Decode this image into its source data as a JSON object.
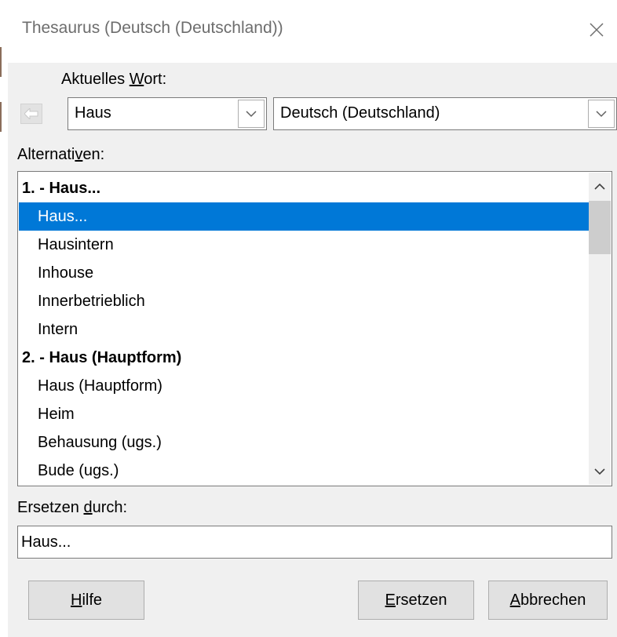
{
  "window": {
    "title": "Thesaurus (Deutsch (Deutschland))",
    "close_icon": "close-icon"
  },
  "current_word": {
    "label_pre": "Aktuelles ",
    "label_u": "W",
    "label_post": "ort:",
    "value": "Haus",
    "language": "Deutsch (Deutschland)",
    "back_icon": "arrow-left-icon"
  },
  "alternatives": {
    "label_pre": "Alternati",
    "label_u": "v",
    "label_post": "en:",
    "rows": [
      {
        "text": "1. - Haus...",
        "type": "heading",
        "selected": false
      },
      {
        "text": "Haus...",
        "type": "item",
        "selected": true
      },
      {
        "text": "Hausintern",
        "type": "item",
        "selected": false
      },
      {
        "text": "Inhouse",
        "type": "item",
        "selected": false
      },
      {
        "text": "Innerbetrieblich",
        "type": "item",
        "selected": false
      },
      {
        "text": "Intern",
        "type": "item",
        "selected": false
      },
      {
        "text": "2. - Haus (Hauptform)",
        "type": "heading",
        "selected": false
      },
      {
        "text": "Haus (Hauptform)",
        "type": "item",
        "selected": false
      },
      {
        "text": "Heim",
        "type": "item",
        "selected": false
      },
      {
        "text": "Behausung (ugs.)",
        "type": "item",
        "selected": false
      },
      {
        "text": "Bude (ugs.)",
        "type": "item",
        "selected": false
      }
    ]
  },
  "replace_with": {
    "label_pre": "Ersetzen ",
    "label_u": "d",
    "label_post": "urch:",
    "value": "Haus..."
  },
  "buttons": {
    "help_u": "H",
    "help_rest": "ilfe",
    "replace_u": "E",
    "replace_rest": "rsetzen",
    "cancel_u": "A",
    "cancel_rest": "bbrechen"
  },
  "colors": {
    "selection": "#0078d7",
    "dialog_bg": "#f0f0f0"
  }
}
